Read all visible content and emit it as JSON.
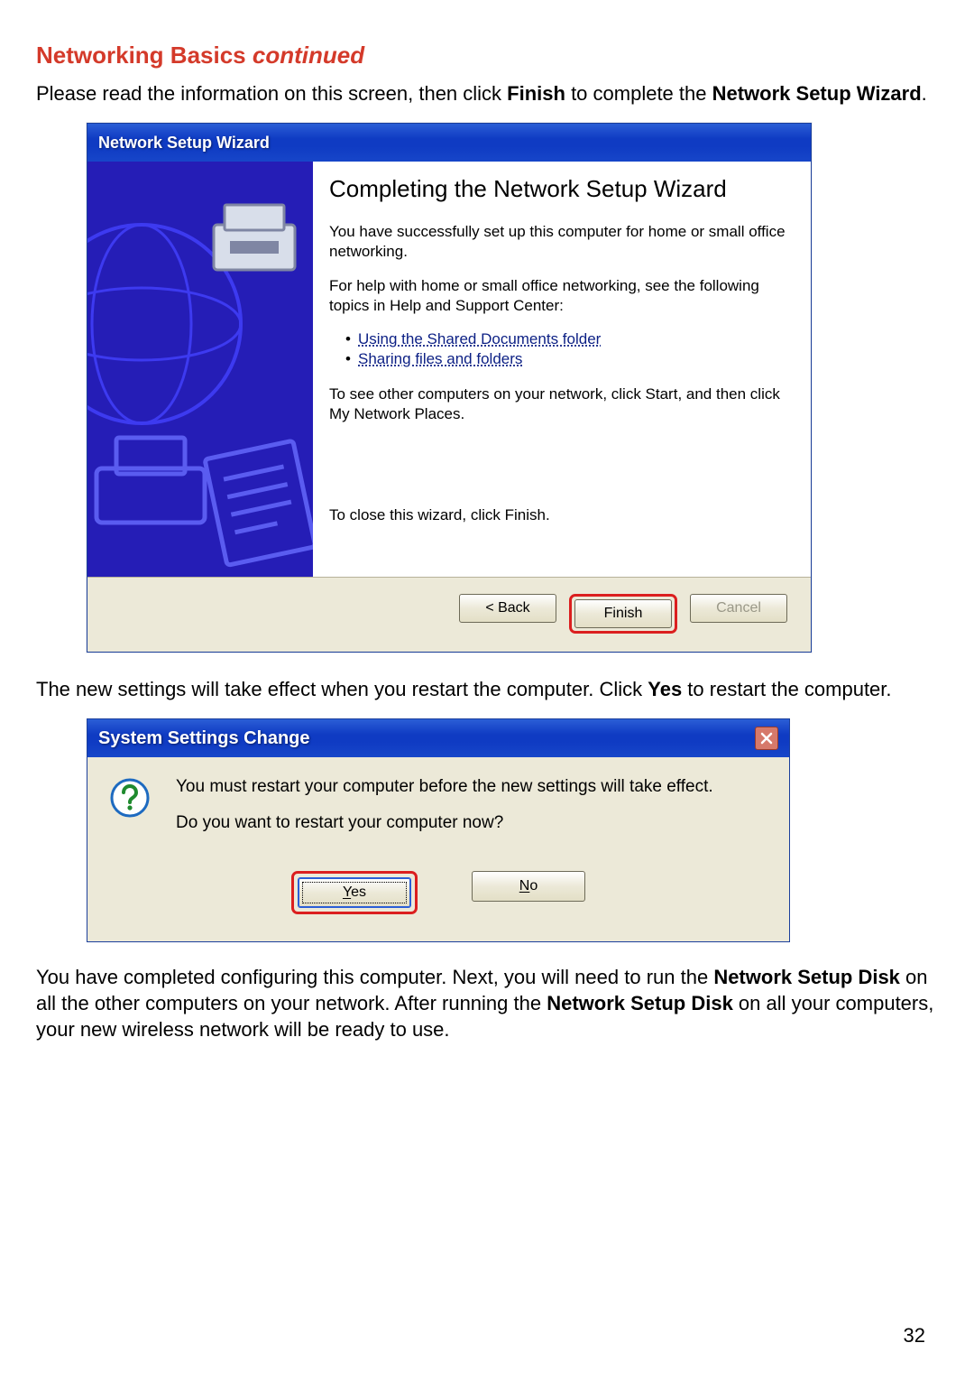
{
  "heading": {
    "main": "Networking Basics",
    "suffix": "continued"
  },
  "intro": {
    "pre": "Please read the information on this screen, then click ",
    "bold1": "Finish",
    "mid": " to complete the ",
    "bold2": "Network Setup Wizard",
    "post": "."
  },
  "wizard": {
    "title": "Network Setup Wizard",
    "heading": "Completing the Network Setup Wizard",
    "p1": "You have successfully set up this computer for home or small office networking.",
    "p2": "For help with home or small office networking, see the following topics in Help and Support Center:",
    "links": [
      "Using the Shared Documents folder",
      "Sharing files and folders"
    ],
    "p3": "To see other computers on your network, click Start, and then click My Network Places.",
    "close_tip": "To close this wizard, click Finish.",
    "buttons": {
      "back": "< Back",
      "finish": "Finish",
      "cancel": "Cancel"
    }
  },
  "para2": {
    "pre": "The new settings will take effect when you restart the computer. Click ",
    "bold": "Yes",
    "post": " to restart the computer."
  },
  "dialog": {
    "title": "System Settings Change",
    "line1": "You must restart your computer before the new settings will take effect.",
    "line2": "Do you want to restart your computer now?",
    "yes_u": "Y",
    "yes_rest": "es",
    "no_u": "N",
    "no_rest": "o"
  },
  "para3": {
    "t1": "You have completed configuring this computer. Next, you will need to run the ",
    "b1": "Network Setup Disk",
    "t2": " on all the other computers on your network.  After running the ",
    "b2": "Network Setup Disk",
    "t3": " on all your computers, your new wireless network will be ready to use."
  },
  "page_number": "32"
}
